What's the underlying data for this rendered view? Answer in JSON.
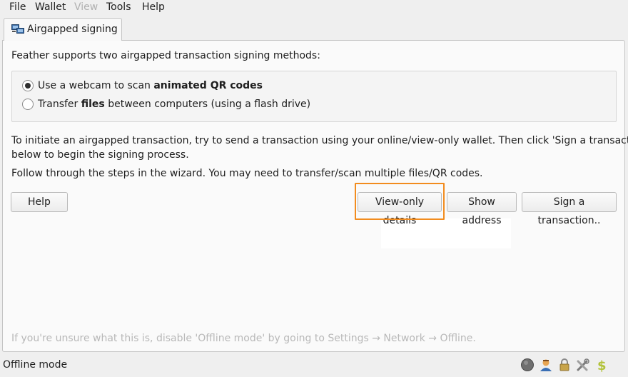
{
  "menu": [
    "File",
    "Wallet",
    "View",
    "Tools",
    "Help"
  ],
  "menu_disabled_index": 2,
  "tab": {
    "label": "Airgapped signing"
  },
  "intro": "Feather supports two airgapped transaction signing methods:",
  "options": {
    "webcam": {
      "prefix": "Use a webcam to scan ",
      "bold": "animated QR codes",
      "suffix": "",
      "checked": true
    },
    "files": {
      "prefix": "Transfer ",
      "bold": "files",
      "suffix": " between computers (using a flash drive)",
      "checked": false
    }
  },
  "instructions": {
    "line1": "To initiate an airgapped transaction, try to send a transaction using your online/view-only wallet. Then click 'Sign a transaction..'",
    "line2": "below to begin the signing process.",
    "line3": "Follow through the steps in the wizard. You may need to transfer/scan multiple files/QR codes."
  },
  "buttons": {
    "help": "Help",
    "view_only": "View-only details",
    "show_address": "Show address",
    "sign": "Sign a transaction.."
  },
  "hint": "If you're unsure what this is, disable 'Offline mode' by going to Settings → Network → Offline.",
  "status": {
    "mode": "Offline mode",
    "icons": [
      "status-circle-icon",
      "user-icon",
      "lock-icon",
      "settings-tools-icon",
      "dollar-icon"
    ]
  },
  "colors": {
    "highlight": "#f28c1e"
  }
}
